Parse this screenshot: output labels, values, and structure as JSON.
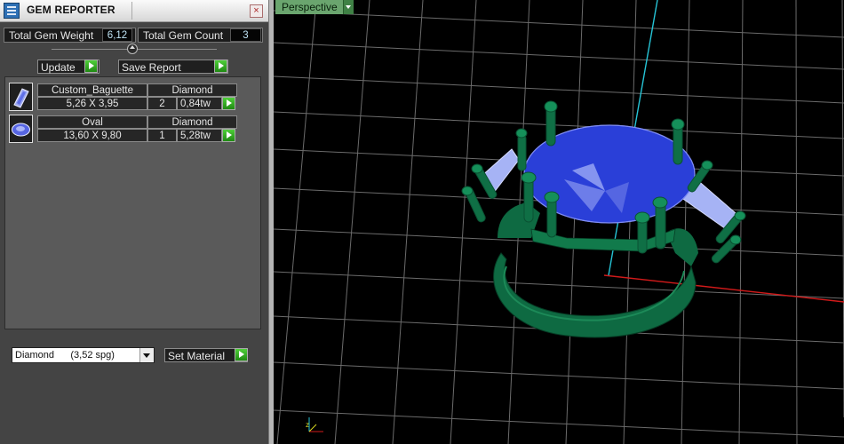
{
  "panel": {
    "title": "GEM REPORTER",
    "close_label": "×",
    "total_weight_label": "Total Gem Weight",
    "total_weight_value": "6,12",
    "total_count_label": "Total Gem Count",
    "total_count_value": "3",
    "update_label": "Update",
    "save_report_label": "Save Report",
    "gems": [
      {
        "name": "Custom_Baguette",
        "size": "5,26 X 3,95",
        "material": "Diamond",
        "qty": "2",
        "weight": "0,84tw",
        "icon": "baguette-gem-icon"
      },
      {
        "name": "Oval",
        "size": "13,60 X 9,80",
        "material": "Diamond",
        "qty": "1",
        "weight": "5,28tw",
        "icon": "oval-gem-icon"
      }
    ],
    "material_select": "Diamond      (3,52 spg)",
    "set_material_label": "Set Material"
  },
  "viewport": {
    "view_label": "Perspective",
    "colors": {
      "grid": "#6b6b6b",
      "ring": "#0e6a42",
      "stone": "#2a3fd8",
      "x_axis": "#d21a1a",
      "y_axis": "#26c4d6"
    }
  }
}
